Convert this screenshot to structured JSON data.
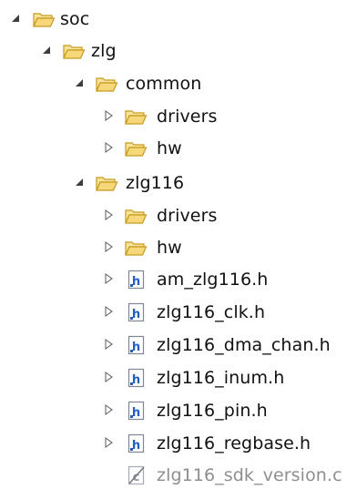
{
  "tree": {
    "soc": {
      "label": "soc",
      "icon": "open-folder-icon",
      "state": "expanded"
    },
    "zlg": {
      "label": "zlg",
      "icon": "open-folder-icon",
      "state": "expanded"
    },
    "common": {
      "label": "common",
      "icon": "open-folder-icon",
      "state": "expanded"
    },
    "common_drivers": {
      "label": "drivers",
      "icon": "folder-icon",
      "state": "collapsed"
    },
    "common_hw": {
      "label": "hw",
      "icon": "folder-icon",
      "state": "collapsed"
    },
    "zlg116": {
      "label": "zlg116",
      "icon": "open-folder-icon",
      "state": "expanded"
    },
    "zlg116_drivers": {
      "label": "drivers",
      "icon": "folder-icon",
      "state": "collapsed"
    },
    "zlg116_hw": {
      "label": "hw",
      "icon": "folder-icon",
      "state": "collapsed"
    },
    "am_zlg116_h": {
      "label": "am_zlg116.h",
      "icon": "header-file-icon",
      "state": "collapsed"
    },
    "zlg116_clk_h": {
      "label": "zlg116_clk.h",
      "icon": "header-file-icon",
      "state": "collapsed"
    },
    "zlg116_dma_chan_h": {
      "label": "zlg116_dma_chan.h",
      "icon": "header-file-icon",
      "state": "collapsed"
    },
    "zlg116_inum_h": {
      "label": "zlg116_inum.h",
      "icon": "header-file-icon",
      "state": "collapsed"
    },
    "zlg116_pin_h": {
      "label": "zlg116_pin.h",
      "icon": "header-file-icon",
      "state": "collapsed"
    },
    "zlg116_regbase_h": {
      "label": "zlg116_regbase.h",
      "icon": "header-file-icon",
      "state": "collapsed"
    },
    "zlg116_sdk_version_c": {
      "label": "zlg116_sdk_version.c",
      "icon": "excluded-c-file-icon",
      "state": "leaf"
    }
  },
  "colors": {
    "folder_fill": "#f6d77a",
    "folder_stroke": "#c79a1e",
    "header_file_blue": "#1f5fc2",
    "arrow_gray": "#5a5a5a",
    "excluded_text": "#8e8e8e"
  }
}
